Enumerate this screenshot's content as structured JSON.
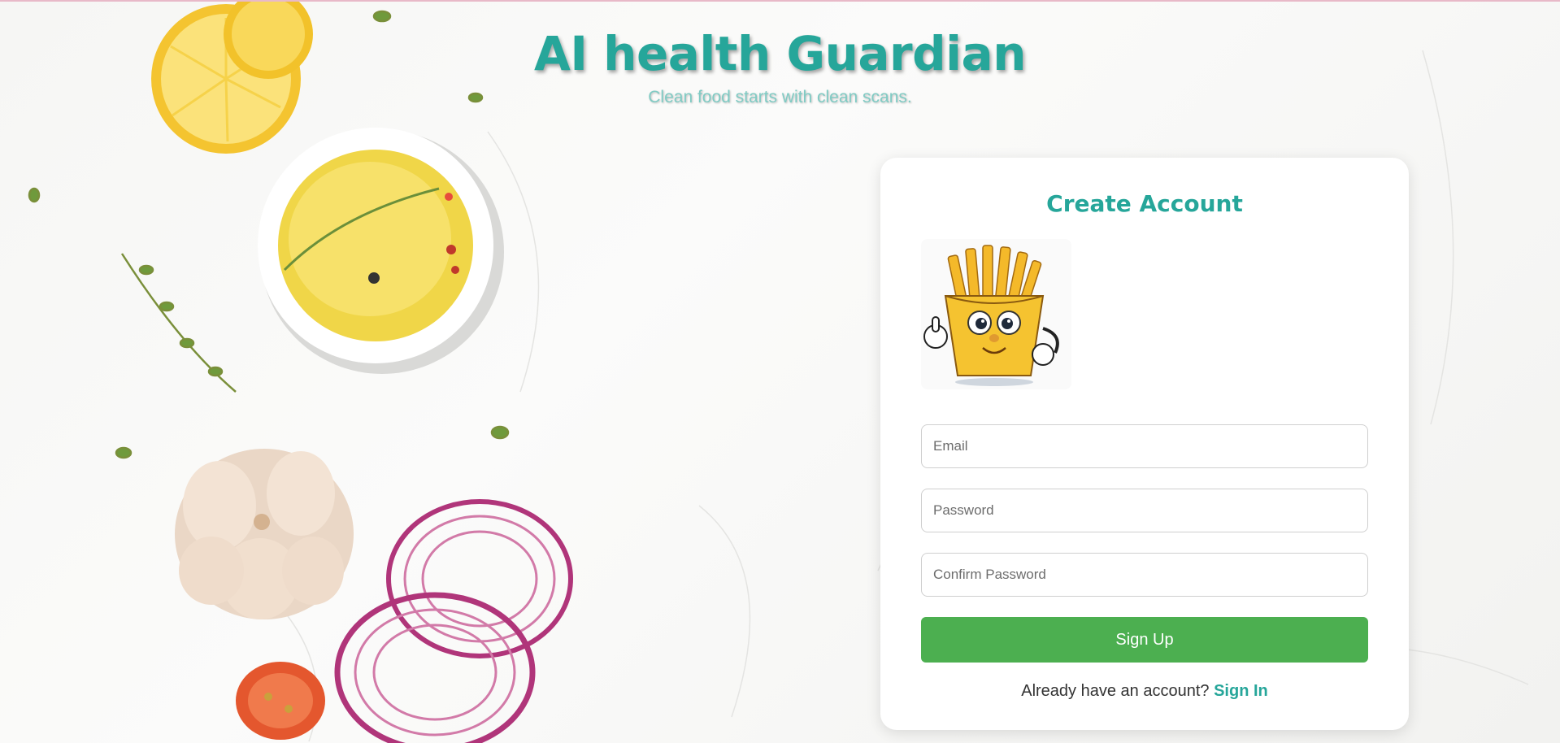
{
  "header": {
    "title": "AI health Guardian",
    "tagline": "Clean food starts with clean scans."
  },
  "signup_card": {
    "title": "Create Account",
    "mascot_icon": "french-fries-mascot-icon",
    "fields": {
      "email_placeholder": "Email",
      "password_placeholder": "Password",
      "confirm_placeholder": "Confirm Password"
    },
    "submit_label": "Sign Up",
    "signin_prompt": "Already have an account?",
    "signin_link": "Sign In"
  },
  "colors": {
    "brand_teal": "#26a69a",
    "tagline_teal": "#80cbc4",
    "button_green": "#4caf50"
  }
}
